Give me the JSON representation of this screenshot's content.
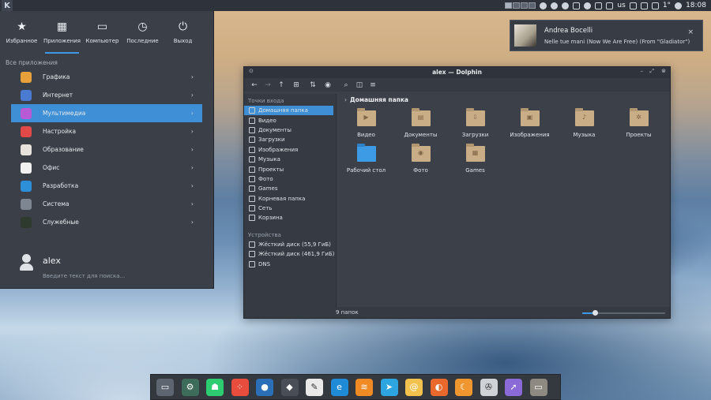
{
  "top_panel": {
    "launcher_label": "K",
    "keyboard_layout": "us",
    "temperature": "1°",
    "clock": "18:08"
  },
  "app_menu": {
    "tabs": [
      {
        "label": "Избранное",
        "icon": "star-icon"
      },
      {
        "label": "Приложения",
        "icon": "grid-icon"
      },
      {
        "label": "Компьютер",
        "icon": "laptop-icon"
      },
      {
        "label": "Последние",
        "icon": "clock-icon"
      },
      {
        "label": "Выход",
        "icon": "power-icon"
      }
    ],
    "active_tab": "Приложения",
    "section_title": "Все приложения",
    "items": [
      {
        "label": "Графика",
        "icon": "graphics-icon",
        "color": "#e8a13a"
      },
      {
        "label": "Интернет",
        "icon": "internet-icon",
        "color": "#4a7bd0"
      },
      {
        "label": "Мультимедиа",
        "icon": "multimedia-icon",
        "color": "#b65ad6"
      },
      {
        "label": "Настройка",
        "icon": "settings-icon",
        "color": "#e24a4a"
      },
      {
        "label": "Образование",
        "icon": "education-icon",
        "color": "#e7e2dc"
      },
      {
        "label": "Офис",
        "icon": "office-icon",
        "color": "#f1f1f1"
      },
      {
        "label": "Разработка",
        "icon": "development-icon",
        "color": "#2d8fd8"
      },
      {
        "label": "Система",
        "icon": "system-icon",
        "color": "#7e8691"
      },
      {
        "label": "Служебные",
        "icon": "utilities-icon",
        "color": "#2f3a2f"
      }
    ],
    "selected_item": "Мультимедиа",
    "user": {
      "name": "alex",
      "search_placeholder": "Введите текст для поиска..."
    }
  },
  "notification": {
    "title": "Andrea Bocelli",
    "body": "Nelle tue mani (Now We Are Free) (From \"Gladiator\")",
    "close": "×"
  },
  "dolphin": {
    "title": "alex — Dolphin",
    "places_header": "Точки входа",
    "places": [
      {
        "label": "Домашняя папка",
        "icon": "home-icon"
      },
      {
        "label": "Видео",
        "icon": "video-icon"
      },
      {
        "label": "Документы",
        "icon": "document-icon"
      },
      {
        "label": "Загрузки",
        "icon": "download-icon"
      },
      {
        "label": "Изображения",
        "icon": "image-icon"
      },
      {
        "label": "Музыка",
        "icon": "music-icon"
      },
      {
        "label": "Проекты",
        "icon": "gear-icon"
      },
      {
        "label": "Фото",
        "icon": "photo-icon"
      },
      {
        "label": "Games",
        "icon": "gamepad-icon"
      },
      {
        "label": "Корневая папка",
        "icon": "folder-icon"
      },
      {
        "label": "Сеть",
        "icon": "network-icon"
      },
      {
        "label": "Корзина",
        "icon": "trash-icon"
      }
    ],
    "devices_header": "Устройства",
    "devices": [
      {
        "label": "Жёсткий диск (55,9 ГиБ)",
        "icon": "hdd-icon"
      },
      {
        "label": "Жёсткий диск (461,9 ГиБ)",
        "icon": "hdd-icon"
      },
      {
        "label": "DNS",
        "icon": "phone-icon"
      }
    ],
    "breadcrumb": "Домашняя папка",
    "folders": [
      {
        "label": "Видео",
        "icon": "folder-video-icon",
        "glyph": "▶"
      },
      {
        "label": "Документы",
        "icon": "folder-documents-icon",
        "glyph": "▤"
      },
      {
        "label": "Загрузки",
        "icon": "folder-downloads-icon",
        "glyph": "⇩"
      },
      {
        "label": "Изображения",
        "icon": "folder-images-icon",
        "glyph": "▣"
      },
      {
        "label": "Музыка",
        "icon": "folder-music-icon",
        "glyph": "♪"
      },
      {
        "label": "Проекты",
        "icon": "folder-projects-icon",
        "glyph": "✲"
      },
      {
        "label": "Рабочий стол",
        "icon": "folder-desktop-icon",
        "glyph": ""
      },
      {
        "label": "Фото",
        "icon": "folder-photo-icon",
        "glyph": "◉"
      },
      {
        "label": "Games",
        "icon": "folder-games-icon",
        "glyph": "▦"
      }
    ],
    "status": "9 папок",
    "zoom_fraction": 0.15
  },
  "dock": [
    {
      "name": "screen-app-icon",
      "color": "#5d6570",
      "glyph": "▭"
    },
    {
      "name": "gear-round-app-icon",
      "color": "#3e6c5a",
      "glyph": "⚙"
    },
    {
      "name": "ghost-app-icon",
      "color": "#2ecc71",
      "glyph": "☗"
    },
    {
      "name": "dots-app-icon",
      "color": "#e74c3c",
      "glyph": "⁘"
    },
    {
      "name": "circle-app-icon",
      "color": "#2a6fb8",
      "glyph": "●"
    },
    {
      "name": "diamond-app-icon",
      "color": "#4a4f57",
      "glyph": "◆"
    },
    {
      "name": "pdf-app-icon",
      "color": "#e9e9e9",
      "glyph": "✎"
    },
    {
      "name": "edge-app-icon",
      "color": "#1f8ad6",
      "glyph": "e"
    },
    {
      "name": "rss-app-icon",
      "color": "#f08a24",
      "glyph": "≋"
    },
    {
      "name": "telegram-app-icon",
      "color": "#2ca5e0",
      "glyph": "➤"
    },
    {
      "name": "mail-app-icon",
      "color": "#f2c14e",
      "glyph": "@"
    },
    {
      "name": "firefox-app-icon",
      "color": "#e8692b",
      "glyph": "◐"
    },
    {
      "name": "croissant-app-icon",
      "color": "#f0962f",
      "glyph": "☾"
    },
    {
      "name": "reel-app-icon",
      "color": "#cfd3d8",
      "glyph": "✇"
    },
    {
      "name": "cursor-app-icon",
      "color": "#8a6ad6",
      "glyph": "➚"
    },
    {
      "name": "file-manager-app-icon",
      "color": "#8e8a82",
      "glyph": "▭"
    }
  ]
}
